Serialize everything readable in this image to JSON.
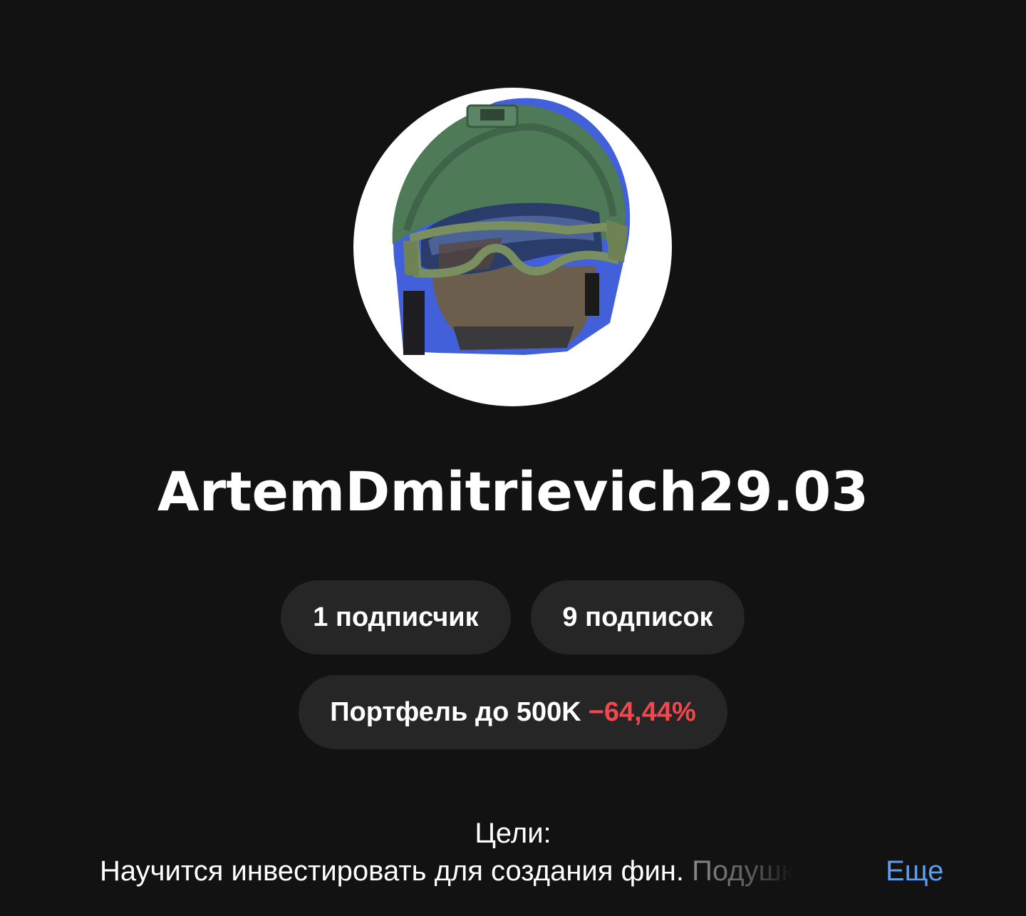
{
  "profile": {
    "username": "ArtemDmitrievich29.03",
    "avatar_icon": "helmet-goggles-avatar-icon"
  },
  "stats": {
    "followers_label": "1 подписчик",
    "following_label": "9 подписок"
  },
  "portfolio": {
    "label": "Портфель до 500K",
    "change": "−64,44%",
    "change_color": "#f0484f"
  },
  "bio": {
    "title": "Цели:",
    "text": "Научится инвестировать для создания фин.",
    "faded_text": "Подушк",
    "more_label": "Еще",
    "more_color": "#5c9ded"
  }
}
